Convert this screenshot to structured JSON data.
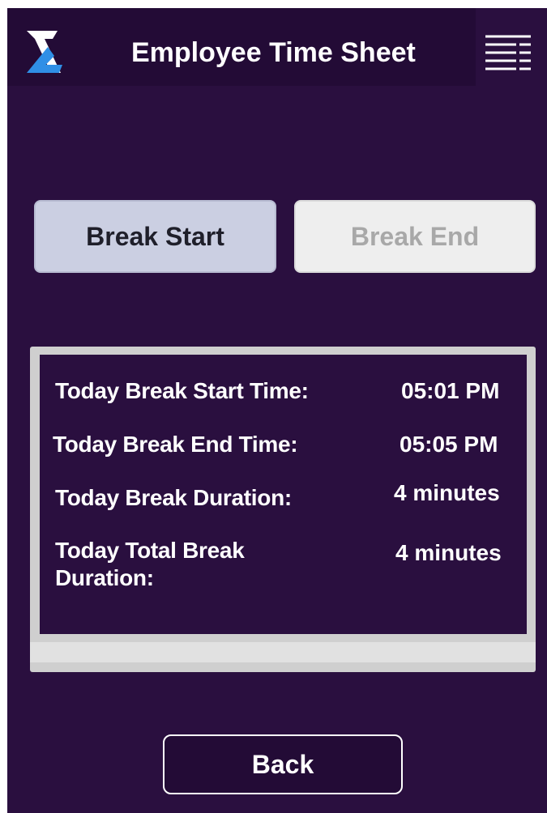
{
  "header": {
    "title": "Employee Time Sheet",
    "logo_icon": "brand-x-logo",
    "menu_icon": "hamburger-menu-icon"
  },
  "actions": {
    "break_start_label": "Break Start",
    "break_end_label": "Break End"
  },
  "summary": {
    "rows": [
      {
        "label": "Today Break Start Time:",
        "value": "05:01 PM"
      },
      {
        "label": "Today Break End Time:",
        "value": "05:05 PM"
      },
      {
        "label": "Today Break Duration:",
        "value": "4 minutes"
      },
      {
        "label": "Today Total Break Duration:",
        "value": "4 minutes"
      }
    ]
  },
  "footer": {
    "back_label": "Back"
  },
  "colors": {
    "background": "#2a0f3f",
    "header_bg": "#230b36",
    "logo_white": "#ffffff",
    "logo_blue": "#2f8fe6",
    "break_start_bg": "#cbcfe2",
    "break_end_bg": "#eeeeee",
    "break_end_text": "#a8a8a8"
  }
}
